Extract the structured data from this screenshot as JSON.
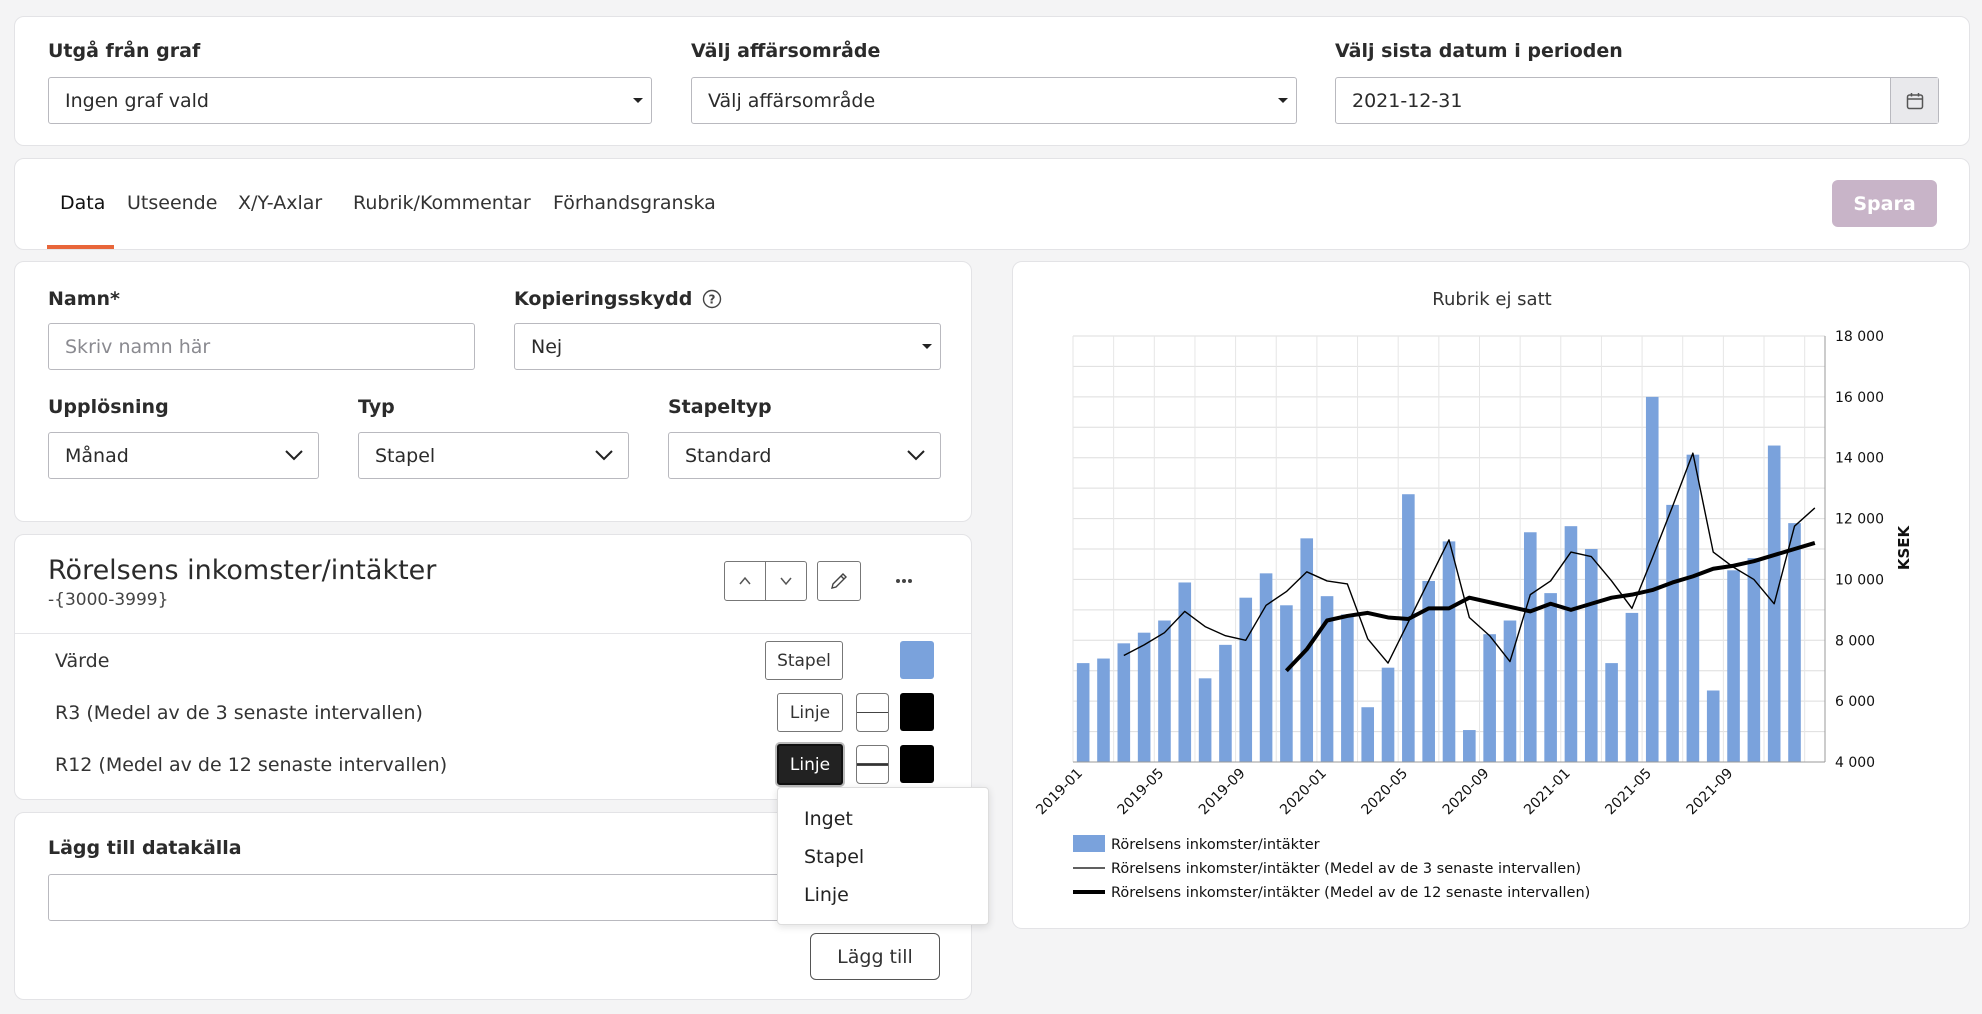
{
  "filters": {
    "graph": {
      "label": "Utgå från graf",
      "value": "Ingen graf vald"
    },
    "area": {
      "label": "Välj affärsområde",
      "value": "Välj affärsområde"
    },
    "date": {
      "label": "Välj sista datum i perioden",
      "value": "2021-12-31"
    }
  },
  "tabs": [
    "Data",
    "Utseende",
    "X/Y-Axlar",
    "Rubrik/Kommentar",
    "Förhandsgranska"
  ],
  "save_label": "Spara",
  "form": {
    "name_label": "Namn*",
    "name_placeholder": "Skriv namn här",
    "copy_label": "Kopieringsskydd",
    "copy_value": "Nej",
    "resolution_label": "Upplösning",
    "resolution_value": "Månad",
    "type_label": "Typ",
    "type_value": "Stapel",
    "stack_label": "Stapeltyp",
    "stack_value": "Standard"
  },
  "series": {
    "title": "Rörelsens inkomster/intäkter",
    "range": "-{3000-3999}",
    "rows": [
      {
        "label": "Värde",
        "type": "Stapel",
        "color": "#7aa2dc"
      },
      {
        "label": "R3 (Medel av de 3 senaste intervallen)",
        "type": "Linje",
        "color": "#000000"
      },
      {
        "label": "R12 (Medel av de 12 senaste intervallen)",
        "type": "Linje",
        "color": "#000000"
      }
    ]
  },
  "dropdown_menu": [
    "Inget",
    "Stapel",
    "Linje"
  ],
  "add_source": {
    "label": "Lägg till datakälla",
    "button": "Lägg till"
  },
  "accent_color": "#e8663a",
  "chart_data": {
    "type": "bar",
    "title": "Rubrik ej satt",
    "ylabel": "KSEK",
    "ylim": [
      4000,
      18000
    ],
    "yticks": [
      "4 000",
      "6 000",
      "8 000",
      "10 000",
      "12 000",
      "14 000",
      "16 000",
      "18 000"
    ],
    "xticks": [
      "2019-01",
      "2019-05",
      "2019-09",
      "2020-01",
      "2020-05",
      "2020-09",
      "2021-01",
      "2021-05",
      "2021-09"
    ],
    "grid": true,
    "legend_position": "bottom",
    "series": [
      {
        "name": "Rörelsens inkomster/intäkter",
        "kind": "bar",
        "color": "#7aa2dc",
        "values": [
          7250,
          7400,
          7900,
          8250,
          8650,
          9900,
          6750,
          7850,
          9400,
          10200,
          9150,
          11350,
          9450,
          8850,
          5800,
          7100,
          12800,
          9950,
          11250,
          5050,
          8200,
          8650,
          11550,
          9550,
          11750,
          11000,
          7250,
          8900,
          16000,
          12450,
          14100,
          6350,
          10300,
          10700,
          14400,
          11850
        ]
      },
      {
        "name": "Rörelsens inkomster/intäkter (Medel av de 3 senaste intervallen)",
        "kind": "line",
        "color": "#000000",
        "values": [
          null,
          null,
          7500,
          7850,
          8250,
          8950,
          8450,
          8150,
          8000,
          9150,
          9600,
          10250,
          9950,
          9850,
          8050,
          7250,
          8600,
          9950,
          11300,
          8750,
          8150,
          7300,
          9500,
          9950,
          10900,
          10750,
          9950,
          9050,
          10700,
          12400,
          14150,
          10900,
          10400,
          10000,
          9200,
          11750,
          12350
        ]
      },
      {
        "name": "Rörelsens inkomster/intäkter (Medel av de 12 senaste intervallen)",
        "kind": "line",
        "color": "#000000",
        "values": [
          null,
          null,
          null,
          null,
          null,
          null,
          null,
          null,
          null,
          null,
          7000,
          7700,
          8650,
          8800,
          8900,
          8750,
          8700,
          9050,
          9050,
          9400,
          9250,
          9100,
          8950,
          9200,
          9000,
          9200,
          9400,
          9500,
          9650,
          9900,
          10100,
          10350,
          10450,
          10600,
          10800,
          11000,
          11200
        ]
      }
    ]
  }
}
